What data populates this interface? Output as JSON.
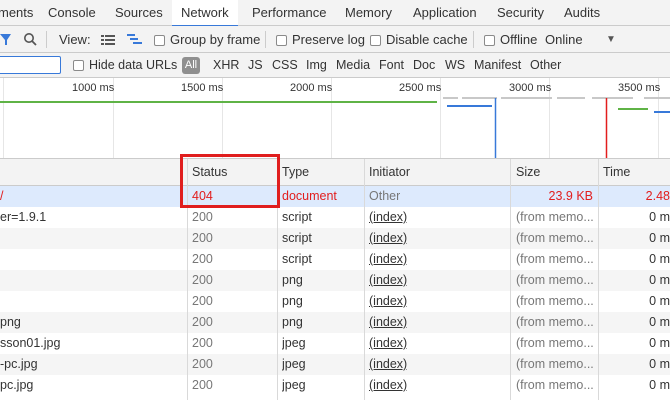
{
  "tabs": [
    "ments",
    "Console",
    "Sources",
    "Network",
    "Performance",
    "Memory",
    "Application",
    "Security",
    "Audits"
  ],
  "toolbar": {
    "view_label": "View:",
    "group_by_frame": "Group by frame",
    "preserve_log": "Preserve log",
    "disable_cache": "Disable cache",
    "offline": "Offline",
    "throttle": "Online"
  },
  "filter": {
    "hide_data_urls": "Hide data URLs",
    "all": "All",
    "types": [
      "XHR",
      "JS",
      "CSS",
      "Img",
      "Media",
      "Font",
      "Doc",
      "WS",
      "Manifest",
      "Other"
    ]
  },
  "timeline": {
    "ticks": [
      "1000 ms",
      "1500 ms",
      "2000 ms",
      "2500 ms",
      "3000 ms",
      "3500 ms"
    ]
  },
  "table": {
    "headers": [
      "Status",
      "Type",
      "Initiator",
      "Size",
      "Time"
    ],
    "rows": [
      {
        "name": "/",
        "status": "404",
        "type": "document",
        "initiator": "Other",
        "size": "23.9 KB",
        "time": "2.48"
      },
      {
        "name": "er=1.9.1",
        "status": "200",
        "type": "script",
        "initiator": "(index)",
        "size": "(from memo...",
        "time": "0 m"
      },
      {
        "name": "",
        "status": "200",
        "type": "script",
        "initiator": "(index)",
        "size": "(from memo...",
        "time": "0 m"
      },
      {
        "name": "",
        "status": "200",
        "type": "script",
        "initiator": "(index)",
        "size": "(from memo...",
        "time": "0 m"
      },
      {
        "name": "",
        "status": "200",
        "type": "png",
        "initiator": "(index)",
        "size": "(from memo...",
        "time": "0 m"
      },
      {
        "name": "",
        "status": "200",
        "type": "png",
        "initiator": "(index)",
        "size": "(from memo...",
        "time": "0 m"
      },
      {
        "name": "png",
        "status": "200",
        "type": "png",
        "initiator": "(index)",
        "size": "(from memo...",
        "time": "0 m"
      },
      {
        "name": "sson01.jpg",
        "status": "200",
        "type": "jpeg",
        "initiator": "(index)",
        "size": "(from memo...",
        "time": "0 m"
      },
      {
        "name": "-pc.jpg",
        "status": "200",
        "type": "jpeg",
        "initiator": "(index)",
        "size": "(from memo...",
        "time": "0 m"
      },
      {
        "name": "pc.jpg",
        "status": "200",
        "type": "jpeg",
        "initiator": "(index)",
        "size": "(from memo...",
        "time": "0 m"
      }
    ]
  },
  "colors": {
    "accent": "#3879d9",
    "error": "#e21d1d",
    "highlight": "#e01e1e",
    "selected_row": "#ddeafd"
  }
}
